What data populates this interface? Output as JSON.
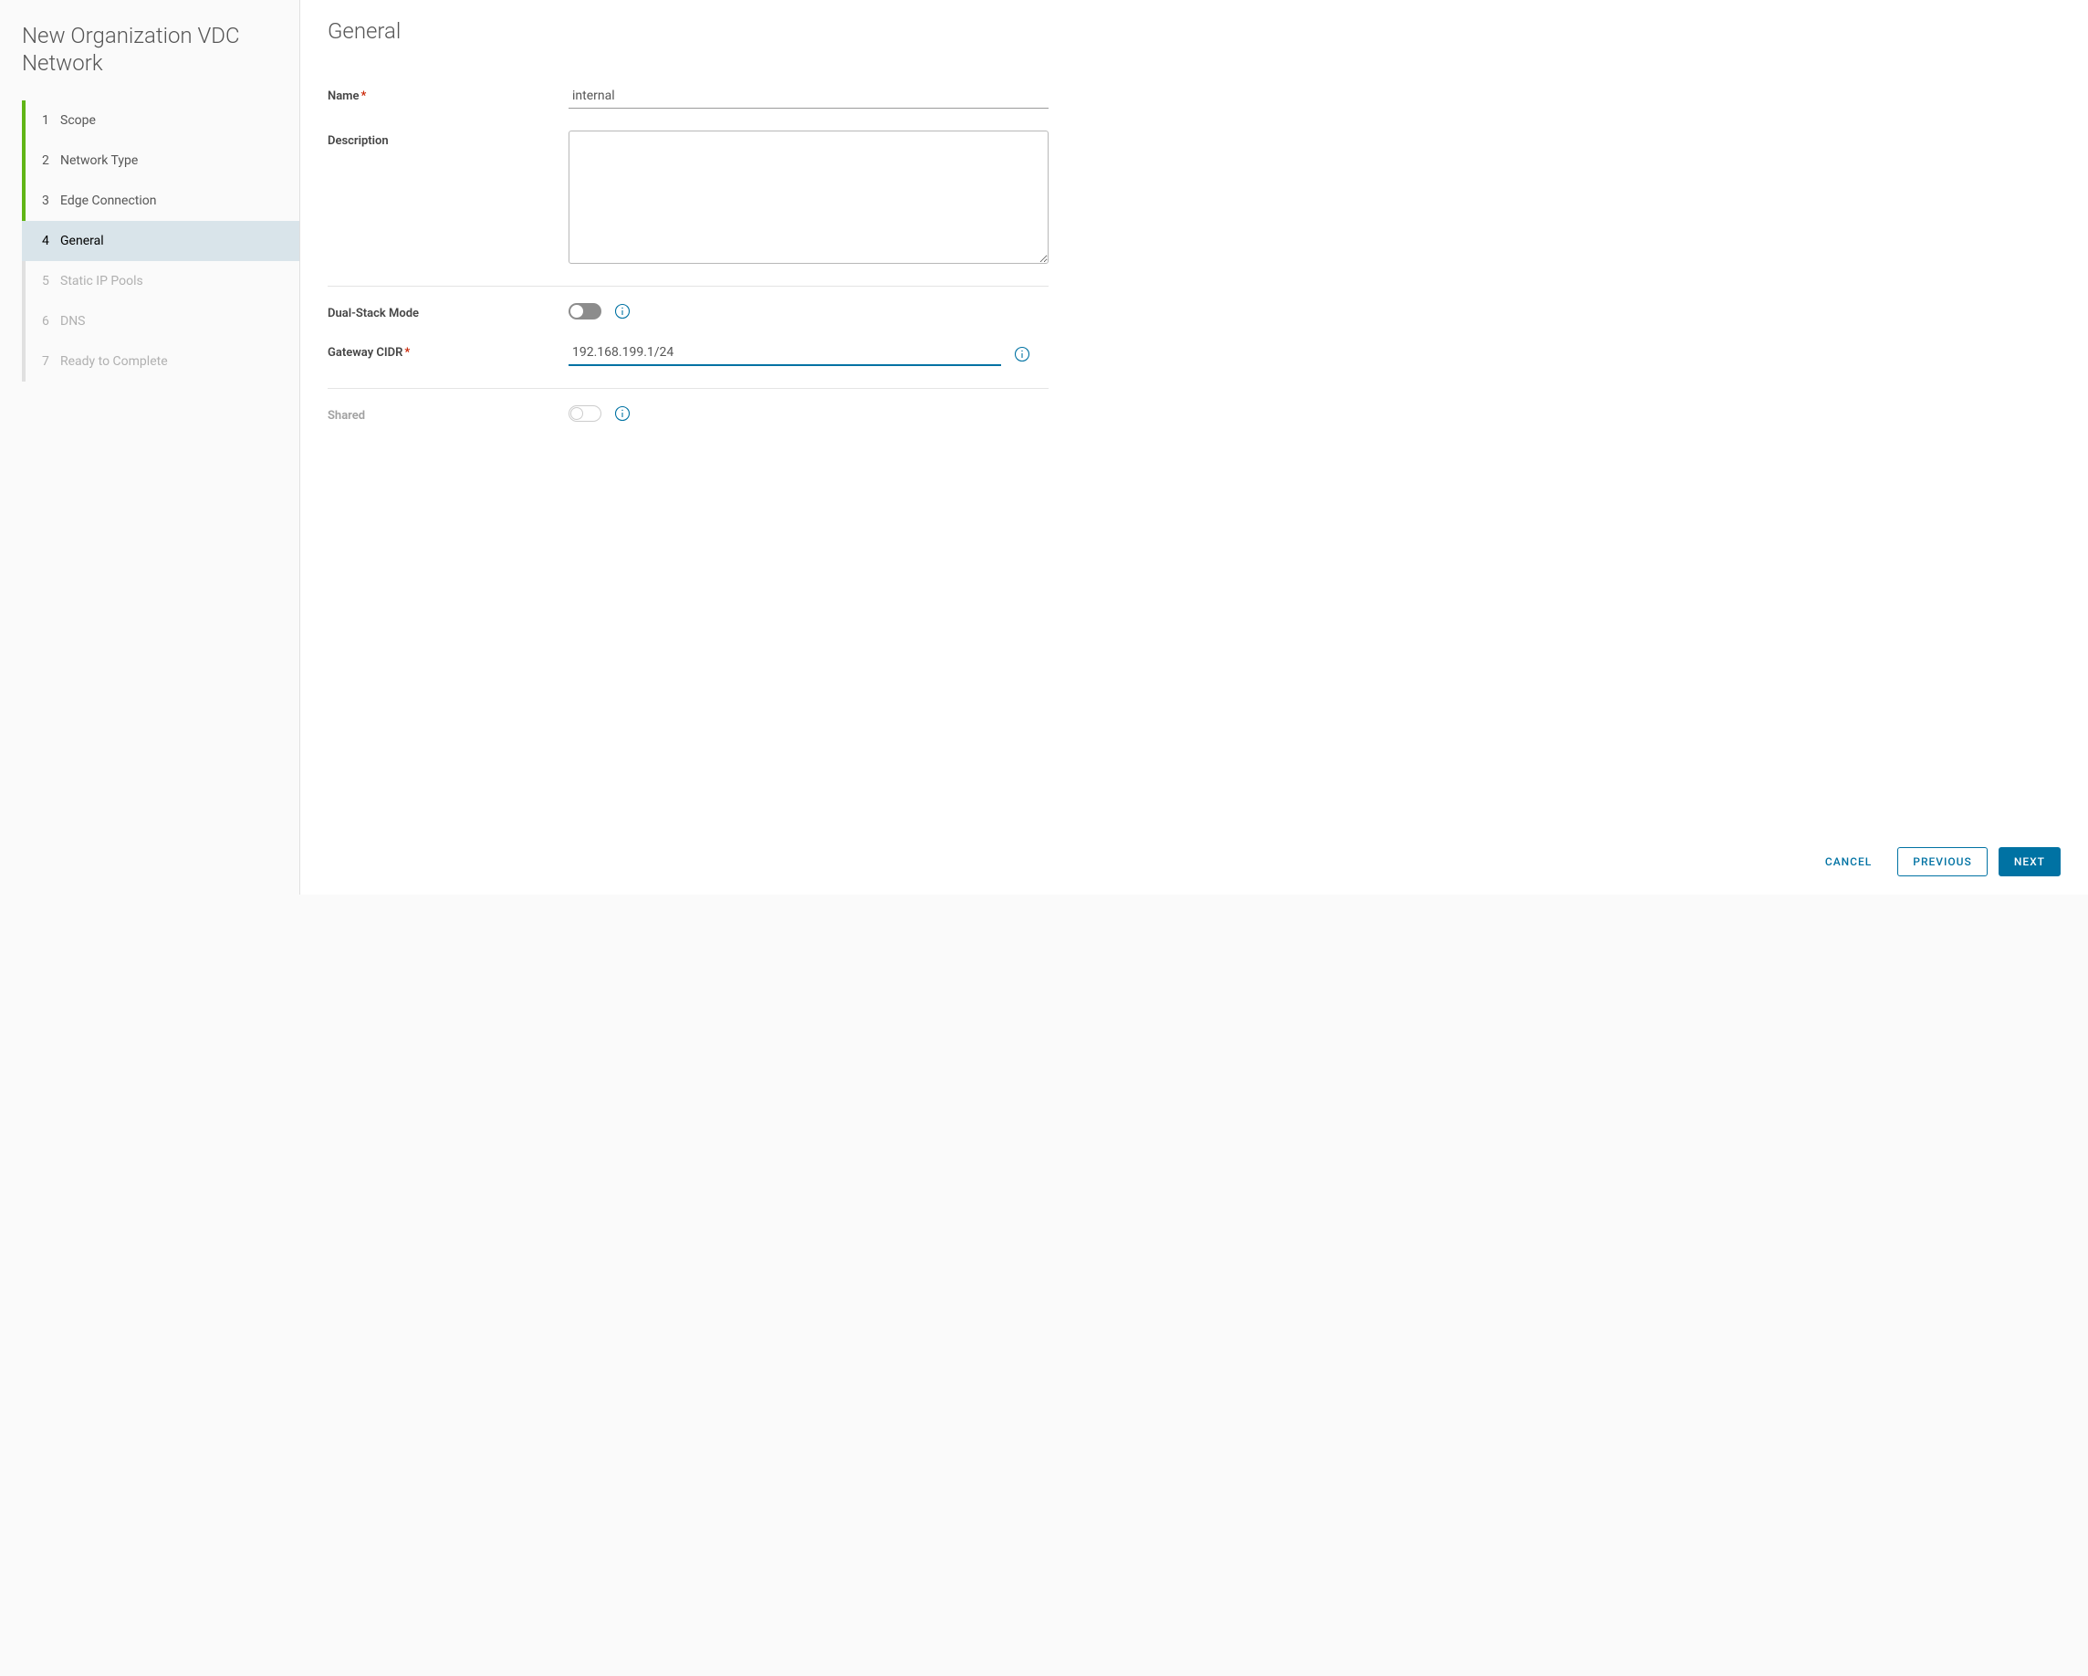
{
  "sidebar": {
    "title": "New Organization VDC Network",
    "steps": [
      {
        "num": "1",
        "label": "Scope",
        "state": "completed"
      },
      {
        "num": "2",
        "label": "Network Type",
        "state": "completed"
      },
      {
        "num": "3",
        "label": "Edge Connection",
        "state": "completed"
      },
      {
        "num": "4",
        "label": "General",
        "state": "active"
      },
      {
        "num": "5",
        "label": "Static IP Pools",
        "state": "disabled"
      },
      {
        "num": "6",
        "label": "DNS",
        "state": "disabled"
      },
      {
        "num": "7",
        "label": "Ready to Complete",
        "state": "disabled"
      }
    ]
  },
  "main": {
    "title": "General",
    "fields": {
      "name_label": "Name",
      "name_value": "internal",
      "description_label": "Description",
      "description_value": "",
      "dual_stack_label": "Dual-Stack Mode",
      "gateway_cidr_label": "Gateway CIDR",
      "gateway_cidr_value": "192.168.199.1/24",
      "shared_label": "Shared"
    },
    "toggles": {
      "dual_stack_on": false,
      "shared_on": false,
      "shared_disabled": true
    }
  },
  "footer": {
    "cancel": "Cancel",
    "previous": "Previous",
    "next": "Next"
  },
  "colors": {
    "accent": "#0072a3",
    "completed": "#60b515",
    "required": "#c92100"
  }
}
